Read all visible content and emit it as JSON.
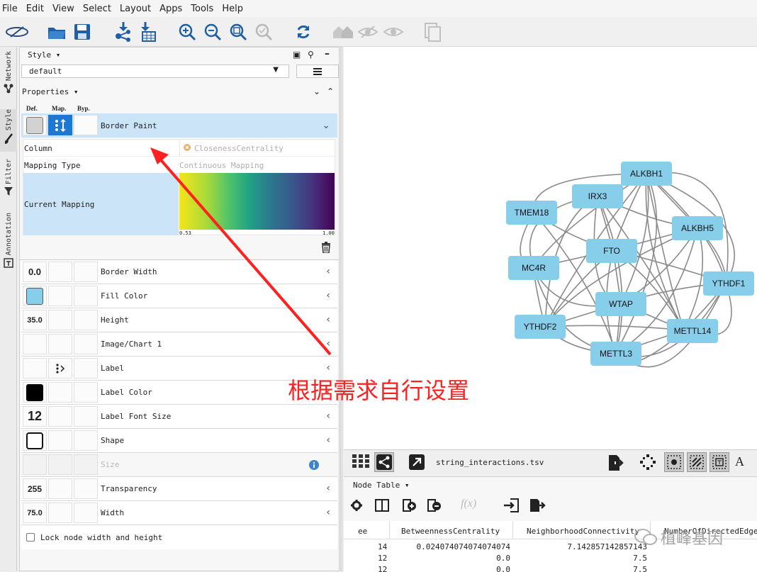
{
  "menu": [
    "File",
    "Edit",
    "View",
    "Select",
    "Layout",
    "Apps",
    "Tools",
    "Help"
  ],
  "side_tabs": [
    "Network",
    "Style",
    "Filter",
    "Annotation"
  ],
  "style_panel": {
    "header": "Style",
    "style_name": "default",
    "properties_label": "Properties",
    "col_def": "Def.",
    "col_map": "Map.",
    "col_byp": "Byp.",
    "mapping": {
      "property": "Border Paint",
      "column_label": "Column",
      "column_value": "ClosenessCentrality",
      "type_label": "Mapping Type",
      "type_value": "Continuous Mapping",
      "current_label": "Current Mapping",
      "min": "0.53",
      "max": "1.00"
    },
    "props": [
      {
        "def": "0.0",
        "label": "Border Width"
      },
      {
        "def": "",
        "label": "Fill Color"
      },
      {
        "def": "35.0",
        "label": "Height"
      },
      {
        "def": "",
        "label": "Image/Chart 1"
      },
      {
        "def": "",
        "label": "Label"
      },
      {
        "def": "",
        "label": "Label Color"
      },
      {
        "def": "12",
        "label": "Label Font Size"
      },
      {
        "def": "",
        "label": "Shape"
      },
      {
        "def": "",
        "label": "Size"
      },
      {
        "def": "255",
        "label": "Transparency"
      },
      {
        "def": "75.0",
        "label": "Width"
      }
    ],
    "lock_label": "Lock node width and height"
  },
  "annotation_text": "根据需求自行设置",
  "network": {
    "nodes": [
      "ALKBH1",
      "IRX3",
      "TMEM18",
      "ALKBH5",
      "FTO",
      "MC4R",
      "YTHDF1",
      "WTAP",
      "YTHDF2",
      "METTL14",
      "METTL3"
    ],
    "tab_file": "string_interactions.tsv"
  },
  "table": {
    "title": "Node Table",
    "headers": [
      "ee",
      "BetweennessCentrality",
      "NeighborhoodConnectivity",
      "NumberOfDirectedEdges"
    ],
    "rows": [
      [
        "14",
        "0.024074074074074074",
        "7.142857142857143",
        ""
      ],
      [
        "12",
        "0.0",
        "7.5",
        ""
      ],
      [
        "12",
        "0.0",
        "7.5",
        ""
      ]
    ]
  },
  "watermark": "植峰基因",
  "colors": {
    "node_fill": "#87CEEB",
    "selected_row": "#cce4f7",
    "annotation": "#ff2020"
  }
}
